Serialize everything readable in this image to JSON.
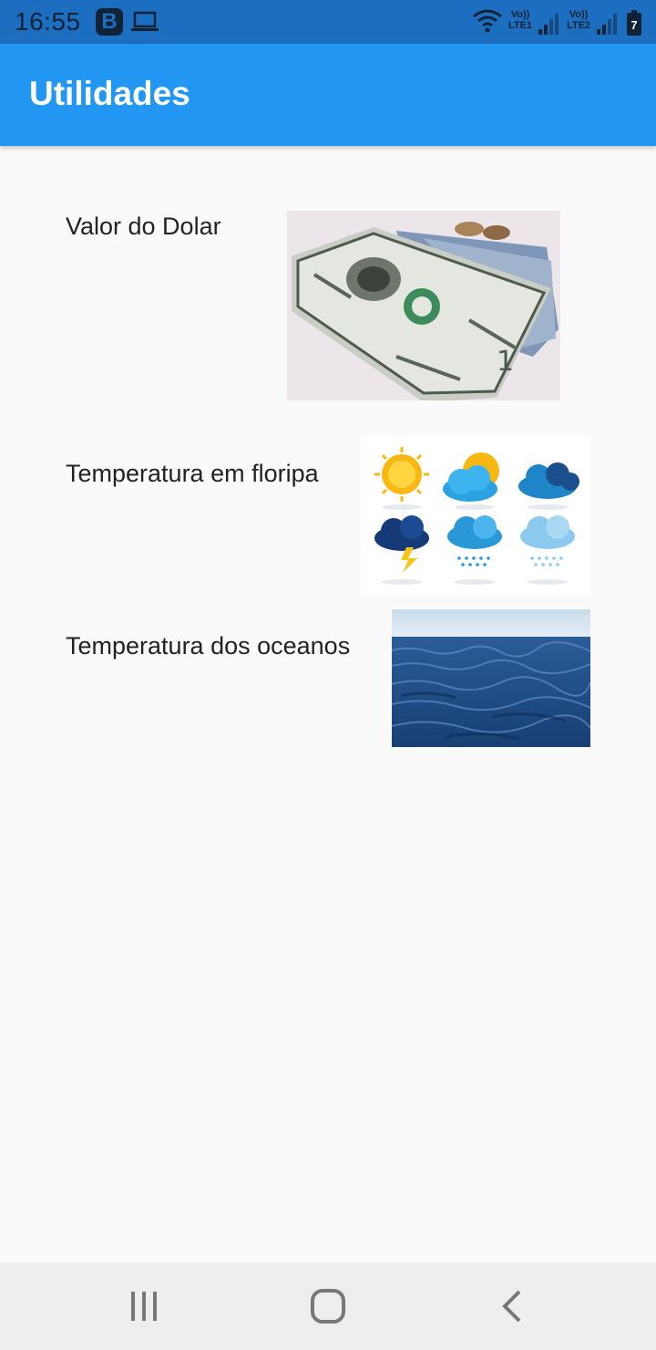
{
  "status_bar": {
    "time": "16:55",
    "notification_b": "B",
    "sim1_label": "Vo))",
    "sim1_net": "LTE1",
    "sim2_label": "Vo))",
    "sim2_net": "LTE2",
    "battery_level": "7",
    "icons": [
      "b-app-icon",
      "laptop-icon",
      "wifi-icon",
      "signal-icon",
      "battery-icon"
    ]
  },
  "app_bar": {
    "title": "Utilidades"
  },
  "items": [
    {
      "label": "Valor do Dolar",
      "image": "dollar-bills-image"
    },
    {
      "label": "Temperatura em floripa",
      "image": "weather-icons-image"
    },
    {
      "label": "Temperatura dos oceanos",
      "image": "ocean-image"
    }
  ],
  "nav_bar": {
    "icons": [
      "recents-icon",
      "home-icon",
      "back-icon"
    ]
  },
  "colors": {
    "status_bar": "#1c6fc0",
    "app_bar": "#2196f3",
    "background": "#fafafa",
    "nav_bar": "#eeeeee"
  }
}
